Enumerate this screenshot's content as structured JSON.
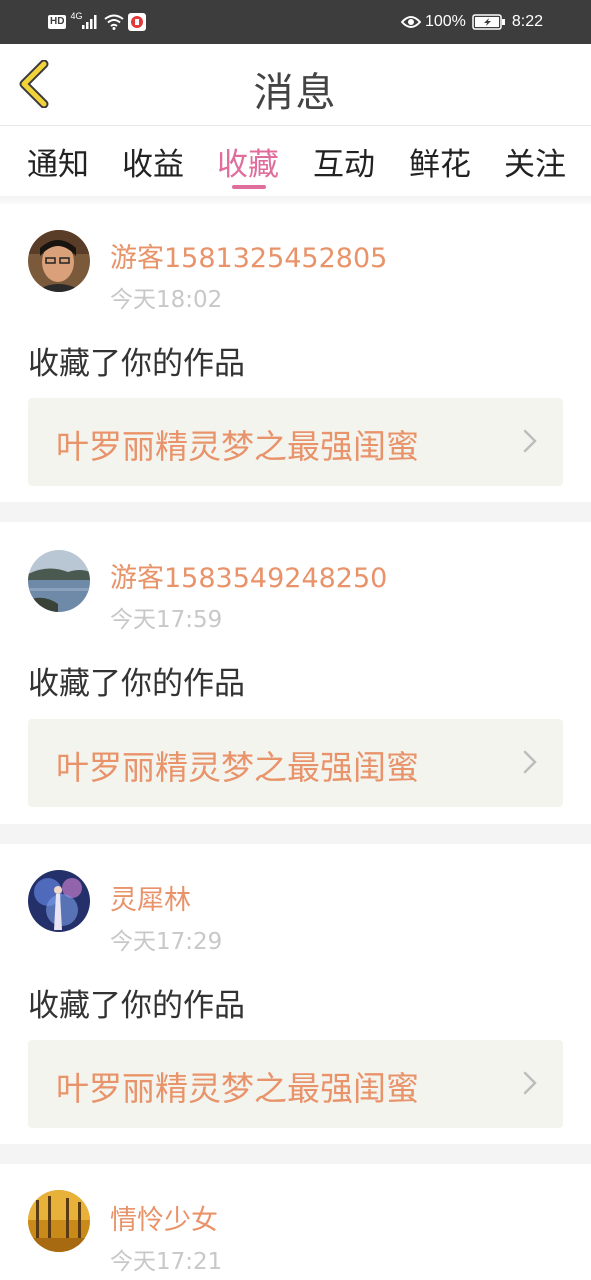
{
  "status_bar": {
    "badge": "HD",
    "network": "4G",
    "battery_percent": "100%",
    "time": "8:22"
  },
  "header": {
    "title": "消息",
    "back_icon": "chevron-left-icon"
  },
  "tabs": [
    {
      "label": "通知",
      "active": false
    },
    {
      "label": "收益",
      "active": false
    },
    {
      "label": "收藏",
      "active": true
    },
    {
      "label": "互动",
      "active": false
    },
    {
      "label": "鲜花",
      "active": false
    },
    {
      "label": "关注",
      "active": false
    }
  ],
  "feed": [
    {
      "username": "游客1581325452805",
      "time": "今天18:02",
      "action": "收藏了你的作品",
      "work_title": "叶罗丽精灵梦之最强闺蜜"
    },
    {
      "username": "游客1583549248250",
      "time": "今天17:59",
      "action": "收藏了你的作品",
      "work_title": "叶罗丽精灵梦之最强闺蜜"
    },
    {
      "username": "灵犀林",
      "time": "今天17:29",
      "action": "收藏了你的作品",
      "work_title": "叶罗丽精灵梦之最强闺蜜"
    },
    {
      "username": "情怜少女",
      "time": "今天17:21"
    }
  ],
  "colors": {
    "accent": "#e06e9c",
    "username": "#e8936a",
    "work_bg": "#f4f4ef",
    "back_icon": "#f2d43a"
  }
}
